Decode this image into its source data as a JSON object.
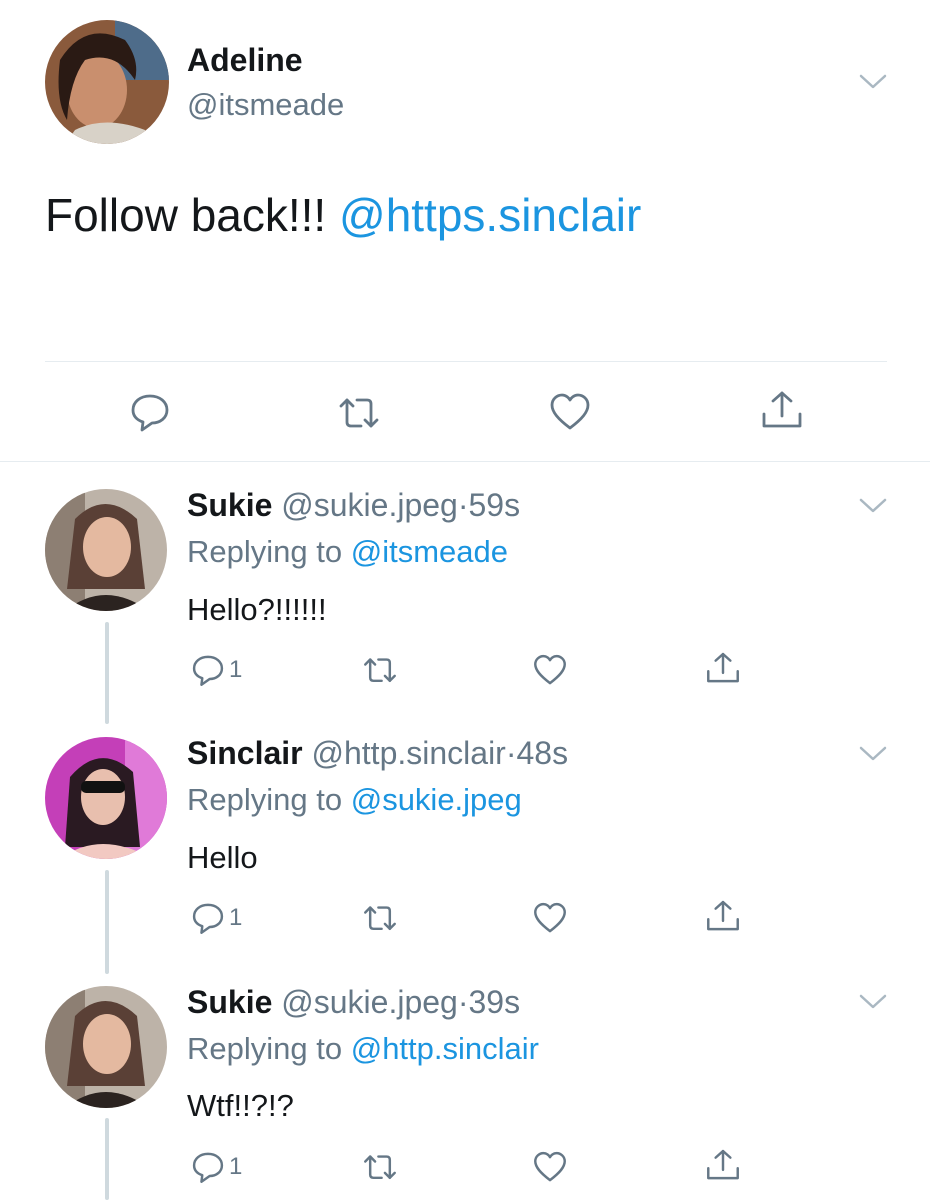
{
  "main_tweet": {
    "display_name": "Adeline",
    "handle": "@itsmeade",
    "text": "Follow back!!!",
    "mention": "@https.sinclair"
  },
  "replies": [
    {
      "display_name": "Sukie",
      "handle": "@sukie.jpeg",
      "time": "59s",
      "replying_prefix": "Replying to",
      "replying_to": "@itsmeade",
      "text": "Hello?!!!!!!",
      "reply_count": "1"
    },
    {
      "display_name": "Sinclair",
      "handle": "@http.sinclair",
      "time": "48s",
      "replying_prefix": "Replying to",
      "replying_to": "@sukie.jpeg",
      "text": "Hello",
      "reply_count": "1"
    },
    {
      "display_name": "Sukie",
      "handle": "@sukie.jpeg",
      "time": "39s",
      "replying_prefix": "Replying to",
      "replying_to": "@http.sinclair",
      "text": "Wtf!!?!?",
      "reply_count": "1"
    }
  ],
  "separator": "·",
  "icons": [
    "reply-icon",
    "retweet-icon",
    "like-icon",
    "share-icon",
    "chevron-down-icon"
  ],
  "colors": {
    "link": "#1b95e0",
    "secondary_text": "#657786",
    "icon": "#657786",
    "thread_line": "#cfd9de"
  }
}
